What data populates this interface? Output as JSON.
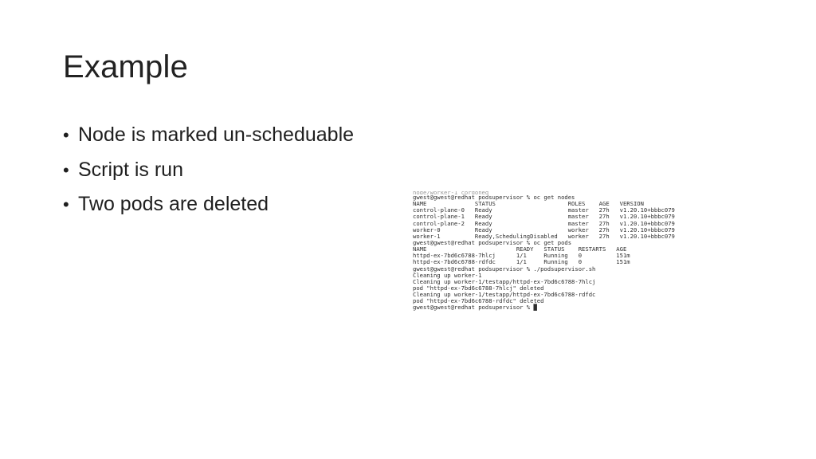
{
  "slide": {
    "title": "Example",
    "bullets": [
      "Node is marked un-scheduable",
      "Script is run",
      "Two pods are deleted"
    ],
    "bullet_glyph": "•"
  },
  "terminal": {
    "lines": [
      "node/worker-1 cordoned",
      "gwest@gwest@redhat podsupervisor % oc get nodes",
      "NAME              STATUS                     ROLES    AGE   VERSION",
      "control-plane-0   Ready                      master   27h   v1.20.10+bbbc079",
      "control-plane-1   Ready                      master   27h   v1.20.10+bbbc079",
      "control-plane-2   Ready                      master   27h   v1.20.10+bbbc079",
      "worker-0          Ready                      worker   27h   v1.20.10+bbbc079",
      "worker-1          Ready,SchedulingDisabled   worker   27h   v1.20.10+bbbc079",
      "gwest@gwest@redhat podsupervisor % oc get pods",
      "NAME                          READY   STATUS    RESTARTS   AGE",
      "httpd-ex-7bd6c6788-7hlcj      1/1     Running   0          151m",
      "httpd-ex-7bd6c6788-rdfdc      1/1     Running   0          151m",
      "gwest@gwest@redhat podsupervisor % ./podsupervisor.sh",
      "Cleaning up worker-1",
      "Cleaning up worker-1/testapp/httpd-ex-7bd6c6788-7hlcj",
      "pod \"httpd-ex-7bd6c6788-7hlcj\" deleted",
      "Cleaning up worker-1/testapp/httpd-ex-7bd6c6788-rdfdc",
      "pod \"httpd-ex-7bd6c6788-rdfdc\" deleted",
      "gwest@gwest@redhat podsupervisor % █"
    ]
  }
}
